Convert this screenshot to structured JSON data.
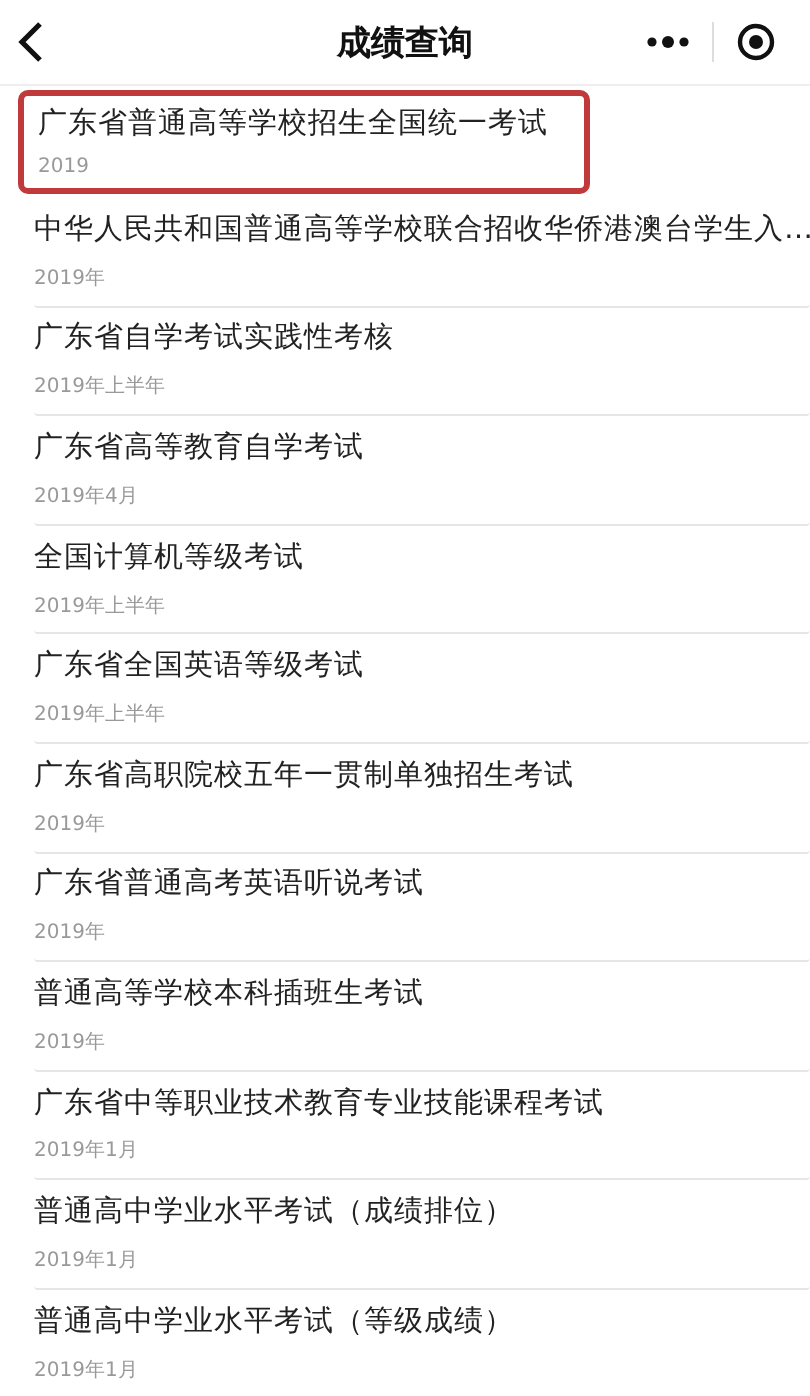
{
  "header": {
    "title": "成绩查询"
  },
  "exams": [
    {
      "title": "广东省普通高等学校招生全国统一考试",
      "date": "2019",
      "highlighted": true
    },
    {
      "title": "中华人民共和国普通高等学校联合招收华侨港澳台学生入…",
      "date": "2019年",
      "highlighted": false
    },
    {
      "title": "广东省自学考试实践性考核",
      "date": "2019年上半年",
      "highlighted": false
    },
    {
      "title": "广东省高等教育自学考试",
      "date": "2019年4月",
      "highlighted": false
    },
    {
      "title": "全国计算机等级考试",
      "date": "2019年上半年",
      "highlighted": false
    },
    {
      "title": "广东省全国英语等级考试",
      "date": "2019年上半年",
      "highlighted": false
    },
    {
      "title": "广东省高职院校五年一贯制单独招生考试",
      "date": "2019年",
      "highlighted": false
    },
    {
      "title": "广东省普通高考英语听说考试",
      "date": "2019年",
      "highlighted": false
    },
    {
      "title": "普通高等学校本科插班生考试",
      "date": "2019年",
      "highlighted": false
    },
    {
      "title": "广东省中等职业技术教育专业技能课程考试",
      "date": "2019年1月",
      "highlighted": false
    },
    {
      "title": "普通高中学业水平考试（成绩排位）",
      "date": "2019年1月",
      "highlighted": false
    },
    {
      "title": "普通高中学业水平考试（等级成绩）",
      "date": "2019年1月",
      "highlighted": false
    }
  ]
}
